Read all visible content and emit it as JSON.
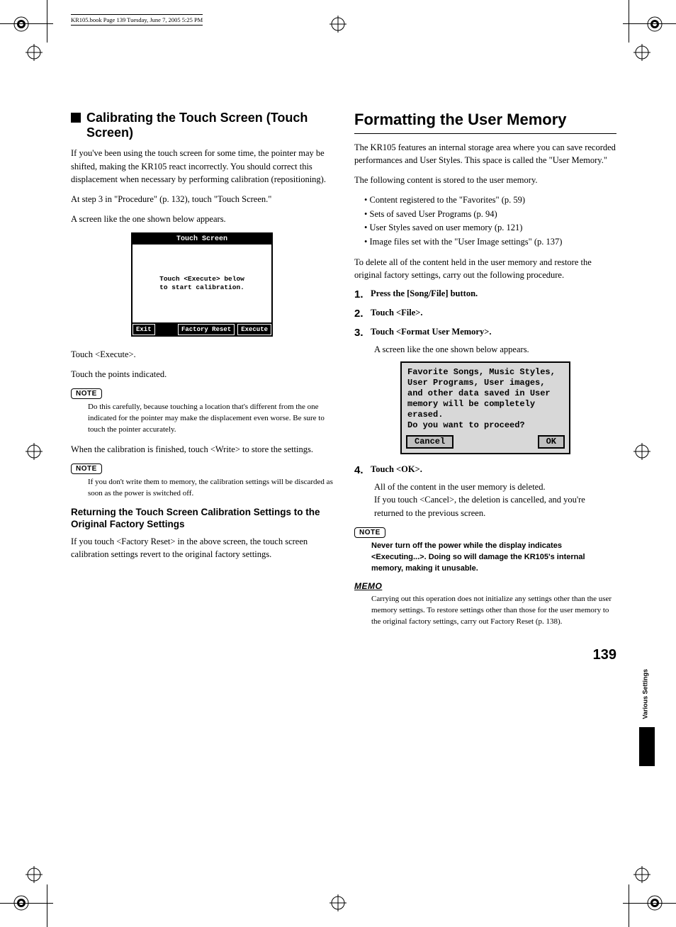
{
  "running_head": "KR105.book  Page 139  Tuesday, June 7, 2005  5:25 PM",
  "page_number": "139",
  "side_label": "Various Settings",
  "left": {
    "h2": "Calibrating the Touch Screen (Touch Screen)",
    "p1": "If you've been using the touch screen for some time, the pointer may be shifted, making the KR105 react incorrectly. You should correct this displacement when necessary by performing calibration (repositioning).",
    "p2": "At step 3 in \"Procedure\" (p. 132), touch \"Touch Screen.\"",
    "p3": "A screen like the one shown below appears.",
    "screen": {
      "title": "Touch Screen",
      "body": "Touch <Execute> below\nto start calibration.",
      "btn_exit": "Exit",
      "btn_factory": "Factory Reset",
      "btn_execute": "Execute"
    },
    "p4": "Touch <Execute>.",
    "p5": "Touch the points indicated.",
    "note1_label": "NOTE",
    "note1_body": "Do this carefully, because touching a location that's different from the one indicated for the pointer may make the displacement even worse. Be sure to touch the pointer accurately.",
    "p6": "When the calibration is finished, touch <Write> to store the settings.",
    "note2_label": "NOTE",
    "note2_body": "If you don't write them to memory, the calibration settings will be discarded as soon as the power is switched off.",
    "h3": "Returning the Touch Screen Calibration Settings to the Original Factory Settings",
    "p7": "If you touch <Factory Reset> in the above screen, the touch screen calibration settings revert to the original factory settings."
  },
  "right": {
    "h1": "Formatting the User Memory",
    "p1": "The KR105 features an internal storage area where you can save recorded performances and User Styles. This space is called the \"User Memory.\"",
    "p2": "The following content is stored to the user memory.",
    "bullets": [
      "Content registered to the \"Favorites\" (p. 59)",
      "Sets of saved User Programs (p. 94)",
      "User Styles saved on user memory (p. 121)",
      "Image files set with the \"User Image settings\" (p. 137)"
    ],
    "p3": "To delete all of the content held in the user memory and restore the original factory settings, carry out the following procedure.",
    "steps": [
      {
        "num": "1.",
        "text": "Press the [Song/File] button."
      },
      {
        "num": "2.",
        "text": "Touch <File>."
      },
      {
        "num": "3.",
        "text": "Touch <Format User Memory>.",
        "after": "A screen like the one shown below appears."
      },
      {
        "num": "4.",
        "text": "Touch <OK>.",
        "after": "All of the content in the user memory is deleted.\nIf you touch <Cancel>, the deletion is cancelled, and you're returned to the previous screen."
      }
    ],
    "screen": {
      "msg": "Favorite Songs, Music Styles, User Programs, User images, and other data saved in User memory will be completely erased.\nDo you want to proceed?",
      "btn_cancel": "Cancel",
      "btn_ok": "OK"
    },
    "note_label": "NOTE",
    "note_body": "Never turn off the power while the display indicates <Executing...>. Doing so will damage the KR105's internal memory, making it unusable.",
    "memo_label": "MEMO",
    "memo_body": "Carrying out this operation does not initialize any settings other than the user memory settings. To restore settings other than those for the user memory to the original factory settings, carry out Factory Reset (p. 138)."
  }
}
